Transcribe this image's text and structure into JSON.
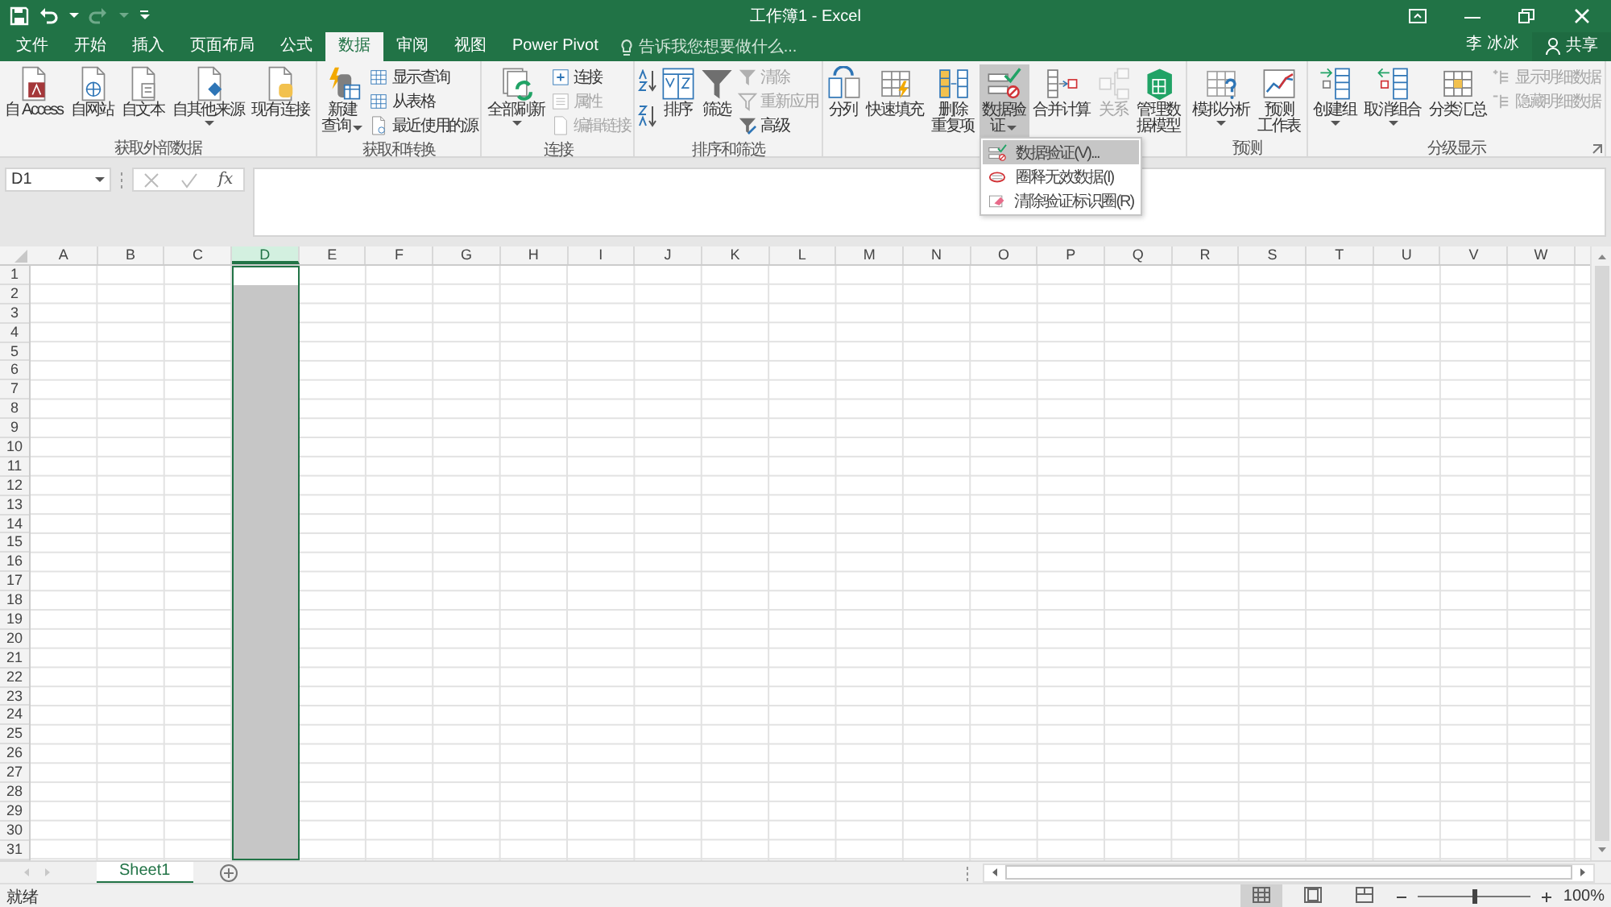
{
  "title_bar": {
    "title": "工作簿1 - Excel"
  },
  "tabs": [
    {
      "label": "文件",
      "selected": false
    },
    {
      "label": "开始",
      "selected": false
    },
    {
      "label": "插入",
      "selected": false
    },
    {
      "label": "页面布局",
      "selected": false
    },
    {
      "label": "公式",
      "selected": false
    },
    {
      "label": "数据",
      "selected": true
    },
    {
      "label": "审阅",
      "selected": false
    },
    {
      "label": "视图",
      "selected": false
    },
    {
      "label": "Power Pivot",
      "selected": false
    }
  ],
  "tell_me": {
    "placeholder": "告诉我您想要做什么..."
  },
  "user": "李 冰冰",
  "share": "共享",
  "ribbon_groups": [
    {
      "label": "获取外部数据",
      "items": [
        {
          "kind": "large",
          "label": "自 Access",
          "disabled": false
        },
        {
          "kind": "large",
          "label": "自网站",
          "disabled": false
        },
        {
          "kind": "large",
          "label": "自文本",
          "disabled": false
        },
        {
          "kind": "large",
          "label": "自其他来源",
          "disabled": false,
          "dropdown": true
        },
        {
          "kind": "large",
          "label": "现有连接",
          "disabled": false
        }
      ]
    },
    {
      "label": "获取和转换",
      "items": [
        {
          "kind": "large",
          "lines": [
            "新建",
            "查询"
          ],
          "disabled": false,
          "dropdown": true
        },
        {
          "kind": "stack",
          "items": [
            {
              "label": "显示查询",
              "disabled": false
            },
            {
              "label": "从表格",
              "disabled": false
            },
            {
              "label": "最近使用的源",
              "disabled": false
            }
          ]
        }
      ]
    },
    {
      "label": "连接",
      "items": [
        {
          "kind": "large",
          "label": "全部刷新",
          "disabled": false,
          "dropdown": true
        },
        {
          "kind": "stack",
          "items": [
            {
              "label": "连接",
              "disabled": false
            },
            {
              "label": "属性",
              "disabled": true
            },
            {
              "label": "编辑链接",
              "disabled": true
            }
          ]
        }
      ]
    },
    {
      "label": "排序和筛选",
      "items": [
        {
          "kind": "sort_icons"
        },
        {
          "kind": "large",
          "label": "排序",
          "disabled": false
        },
        {
          "kind": "large",
          "label": "筛选",
          "disabled": false
        },
        {
          "kind": "stack",
          "items": [
            {
              "label": "清除",
              "disabled": true
            },
            {
              "label": "重新应用",
              "disabled": true
            },
            {
              "label": "高级",
              "disabled": false
            }
          ]
        }
      ]
    },
    {
      "items": [
        {
          "kind": "large",
          "label": "分列",
          "disabled": false
        },
        {
          "kind": "large",
          "label": "快速填充",
          "disabled": false
        },
        {
          "kind": "large",
          "lines": [
            "删除",
            "重复项"
          ],
          "disabled": false
        },
        {
          "kind": "large",
          "lines": [
            "数据验",
            "证"
          ],
          "disabled": false,
          "dropdown": true,
          "pressed": true,
          "menu": [
            {
              "label": "数据验证(V)...",
              "selected": true
            },
            {
              "label": "圈释无效数据(I)",
              "selected": false
            },
            {
              "label": "清除验证标识圈(R)",
              "selected": false
            }
          ]
        },
        {
          "kind": "large",
          "label": "合并计算",
          "disabled": false
        },
        {
          "kind": "large",
          "label": "关系",
          "disabled": true
        },
        {
          "kind": "large",
          "lines": [
            "管理数",
            "据模型"
          ],
          "disabled": false
        }
      ]
    },
    {
      "label": "预测",
      "items": [
        {
          "kind": "large",
          "label": "模拟分析",
          "disabled": false,
          "dropdown": true
        },
        {
          "kind": "large",
          "lines": [
            "预测",
            "工作表"
          ],
          "disabled": false
        }
      ]
    },
    {
      "label": "分级显示",
      "launcher": true,
      "items": [
        {
          "kind": "large",
          "label": "创建组",
          "disabled": false,
          "dropdown": true
        },
        {
          "kind": "large",
          "label": "取消组合",
          "disabled": false,
          "dropdown": true
        },
        {
          "kind": "large",
          "label": "分类汇总",
          "disabled": false
        },
        {
          "kind": "stack",
          "items": [
            {
              "label": "显示明细数据",
              "disabled": true
            },
            {
              "label": "隐藏明细数据",
              "disabled": true
            }
          ]
        }
      ]
    }
  ],
  "formula_bar": {
    "name_box": "D1",
    "fx": "fx"
  },
  "grid": {
    "columns": [
      {
        "label": "A",
        "selected": false
      },
      {
        "label": "B",
        "selected": false
      },
      {
        "label": "C",
        "selected": false
      },
      {
        "label": "D",
        "selected": true
      },
      {
        "label": "E",
        "selected": false
      },
      {
        "label": "F",
        "selected": false
      },
      {
        "label": "G",
        "selected": false
      },
      {
        "label": "H",
        "selected": false
      },
      {
        "label": "I",
        "selected": false
      },
      {
        "label": "J",
        "selected": false
      },
      {
        "label": "K",
        "selected": false
      },
      {
        "label": "L",
        "selected": false
      },
      {
        "label": "M",
        "selected": false
      },
      {
        "label": "N",
        "selected": false
      },
      {
        "label": "O",
        "selected": false
      },
      {
        "label": "P",
        "selected": false
      },
      {
        "label": "Q",
        "selected": false
      },
      {
        "label": "R",
        "selected": false
      },
      {
        "label": "S",
        "selected": false
      },
      {
        "label": "T",
        "selected": false
      },
      {
        "label": "U",
        "selected": false
      },
      {
        "label": "V",
        "selected": false
      },
      {
        "label": "W",
        "selected": false
      }
    ],
    "rows": [
      "1",
      "2",
      "3",
      "4",
      "5",
      "6",
      "7",
      "8",
      "9",
      "10",
      "11",
      "12",
      "13",
      "14",
      "15",
      "16",
      "17",
      "18",
      "19",
      "20",
      "21",
      "22",
      "23",
      "24",
      "25",
      "26",
      "27",
      "28",
      "29",
      "30",
      "31"
    ]
  },
  "sheets": [
    {
      "label": "Sheet1",
      "selected": true
    }
  ],
  "status_bar": {
    "text": "就绪",
    "views": [
      {
        "selected": true
      },
      {
        "selected": false
      },
      {
        "selected": false
      }
    ],
    "zoom": {
      "level": 0.5,
      "reading": "100%"
    }
  }
}
